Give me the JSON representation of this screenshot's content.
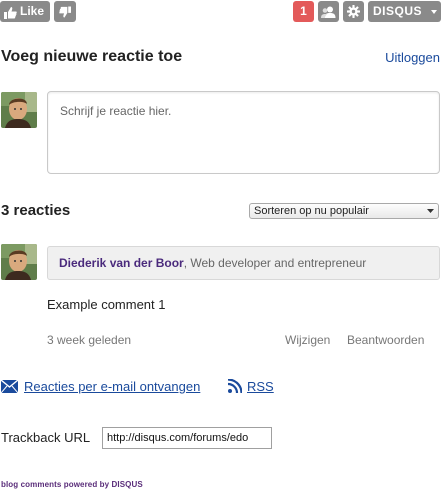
{
  "toolbar": {
    "like_label": "Like",
    "notification_count": "1",
    "disqus_label": "DISQUS",
    "icons": [
      "thumbs-up-icon",
      "thumbs-down-icon",
      "community-icon",
      "gear-icon",
      "chevron-down-icon"
    ],
    "notification_color": "#e35a5a",
    "button_color": "#8a8a8a"
  },
  "new_comment": {
    "title": "Voeg nieuwe reactie toe",
    "logout_label": "Uitloggen",
    "placeholder": "Schrijf je reactie hier."
  },
  "comments_header": {
    "count_label": "3 reacties",
    "sort_selected": "Sorteren op nu populair"
  },
  "comment": {
    "author_name": "Diederik van der Boor",
    "author_tagline": ", Web developer and entrepreneur",
    "text": "Example comment 1",
    "time": "3 week geleden",
    "edit_label": "Wijzigen",
    "reply_label": "Beantwoorden"
  },
  "subscribe": {
    "email_label": "Reacties per e-mail ontvangen",
    "rss_label": "RSS"
  },
  "trackback": {
    "label": "Trackback URL",
    "value": "http://disqus.com/forums/edo"
  },
  "footer": {
    "powered_by": "blog comments powered by DISQUS"
  },
  "colors": {
    "link": "#1a4a9c",
    "author": "#4a2a7c",
    "powered": "#5a2d7a"
  }
}
